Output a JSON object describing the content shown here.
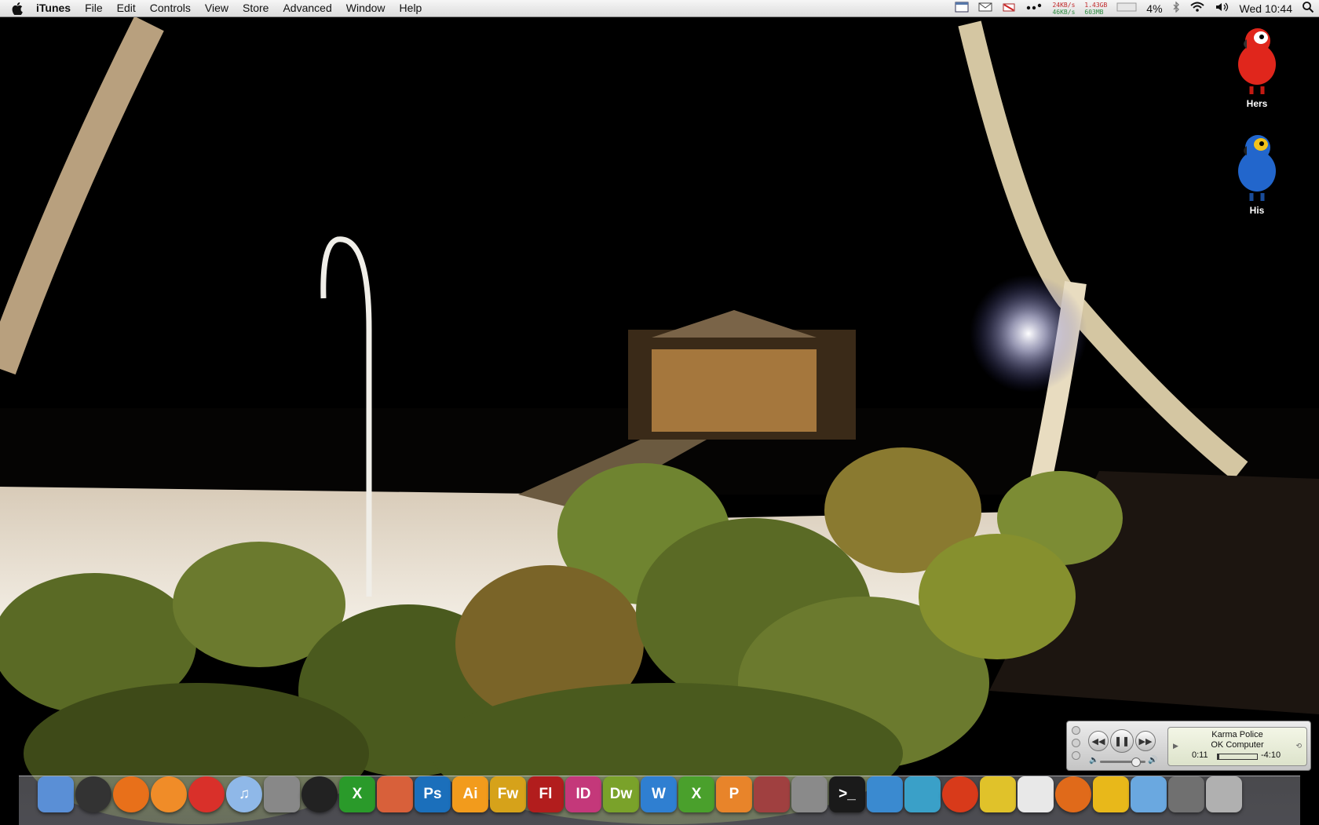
{
  "menubar": {
    "app_name": "iTunes",
    "menus": [
      "File",
      "Edit",
      "Controls",
      "View",
      "Store",
      "Advanced",
      "Window",
      "Help"
    ],
    "netstat": {
      "up": "24KB/s",
      "down": "46KB/s"
    },
    "memstat": {
      "used": "1.43GB",
      "free": "603MB"
    },
    "battery": "4%",
    "clock": "Wed 10:44"
  },
  "desktop": {
    "icons": [
      {
        "label": "Hers",
        "icon": "red-parrot-icon",
        "color": "#e0261c"
      },
      {
        "label": "His",
        "icon": "blue-parrot-icon",
        "color": "#2266cc"
      }
    ]
  },
  "miniplayer": {
    "track": "Karma Police",
    "album": "OK Computer",
    "elapsed": "0:11",
    "remaining": "-4:10",
    "progress": 0.04
  },
  "dock": [
    {
      "name": "finder",
      "label": "",
      "color": "#5a8fd6"
    },
    {
      "name": "dashboard",
      "label": "",
      "color": "#333333",
      "round": true
    },
    {
      "name": "firefox",
      "label": "",
      "color": "#e8701a",
      "round": true
    },
    {
      "name": "firefox-alt",
      "label": "",
      "color": "#f08c28",
      "round": true
    },
    {
      "name": "safari",
      "label": "",
      "color": "#d9302a",
      "round": true
    },
    {
      "name": "itunes",
      "label": "♫",
      "color": "#8fb8e8",
      "round": true
    },
    {
      "name": "iphoto",
      "label": "",
      "color": "#888888"
    },
    {
      "name": "aperture",
      "label": "",
      "color": "#222222",
      "round": true
    },
    {
      "name": "xchat",
      "label": "X",
      "color": "#2a9a2a"
    },
    {
      "name": "bridge",
      "label": "",
      "color": "#d8603a"
    },
    {
      "name": "photoshop",
      "label": "Ps",
      "color": "#1b6fbb"
    },
    {
      "name": "illustrator",
      "label": "Ai",
      "color": "#f29b1c"
    },
    {
      "name": "fireworks",
      "label": "Fw",
      "color": "#d6a21a"
    },
    {
      "name": "flash",
      "label": "Fl",
      "color": "#b21d1d"
    },
    {
      "name": "indesign",
      "label": "ID",
      "color": "#c4387a"
    },
    {
      "name": "dreamweaver",
      "label": "Dw",
      "color": "#7aa22a"
    },
    {
      "name": "word",
      "label": "W",
      "color": "#2f7fd1"
    },
    {
      "name": "excel",
      "label": "X",
      "color": "#4aa02c"
    },
    {
      "name": "powerpoint",
      "label": "P",
      "color": "#e8842a"
    },
    {
      "name": "vmware",
      "label": "",
      "color": "#a04040"
    },
    {
      "name": "system-preferences",
      "label": "",
      "color": "#8a8a8a"
    },
    {
      "name": "terminal",
      "label": ">_",
      "color": "#1a1a1a"
    },
    {
      "name": "preview",
      "label": "",
      "color": "#3a8ad0"
    },
    {
      "name": "utility",
      "label": "",
      "color": "#3aa0c8"
    },
    {
      "name": "tomato",
      "label": "",
      "color": "#d83a1a",
      "round": true
    },
    {
      "name": "adium",
      "label": "",
      "color": "#e0c22a"
    },
    {
      "name": "textedit",
      "label": "",
      "color": "#e8e8e8"
    },
    {
      "name": "firefox-3",
      "label": "",
      "color": "#e06a1a",
      "round": true
    },
    {
      "name": "transmit",
      "label": "",
      "color": "#e8b81a"
    },
    {
      "name": "documents-folder",
      "label": "",
      "color": "#6aa8e0"
    },
    {
      "name": "stack",
      "label": "",
      "color": "#707070"
    },
    {
      "name": "trash",
      "label": "",
      "color": "#b0b0b0"
    }
  ]
}
